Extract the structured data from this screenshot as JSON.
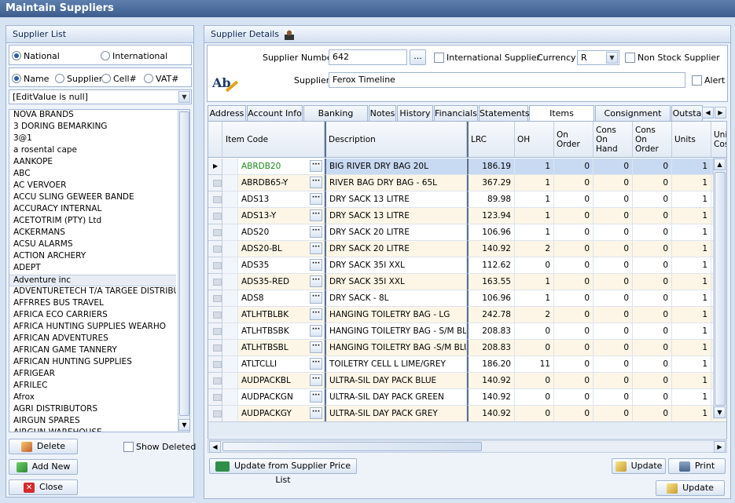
{
  "window": {
    "title": "Maintain Suppliers"
  },
  "left": {
    "header": "Supplier List",
    "scope": {
      "national": "National",
      "international": "International"
    },
    "search_by": {
      "name": "Name",
      "supplier": "Supplier",
      "cell": "Cell#",
      "vat": "VAT#"
    },
    "filter_value": "[EditValue is null]",
    "suppliers": [
      " NOVA BRANDS",
      "3 DORING BEMARKING",
      "3@1",
      "a rosental cape",
      "AANKOPE",
      "ABC",
      "AC VERVOER",
      "ACCU SLING GEWEER BANDE",
      "ACCURACY INTERNAL",
      "ACETOTRIM (PTY) Ltd",
      "ACKERMANS",
      "ACSU ALARMS",
      "ACTION ARCHERY",
      "ADEPT",
      "Adventure inc",
      "ADVENTURETECH T/A TARGEE DISTRIBUT",
      "AFFRRES BUS TRAVEL",
      "AFRICA ECO CARRIERS",
      "AFRICA HUNTING SUPPLIES WEARHO",
      "AFRICAN ADVENTURES",
      "AFRICAN GAME TANNERY",
      "AFRICAN HUNTING SUPPLIES",
      "AFRIGEAR",
      "AFRILEC",
      "Afrox",
      "AGRI DISTRIBUTORS",
      "AIRGUN SPARES",
      "AIRGUN WAREHOUSE"
    ],
    "selected_index": 14,
    "delete_label": "Delete",
    "show_deleted_label": "Show Deleted",
    "add_new_label": "Add New",
    "close_label": "Close"
  },
  "right": {
    "header": "Supplier Details",
    "supplier_number_label": "Supplier Number",
    "supplier_number": "642",
    "ellipsis": "...",
    "international_label": "International Supplier",
    "currency_label": "Currency",
    "currency": "R",
    "non_stock_label": "Non Stock Supplier",
    "supplier_label": "Supplier",
    "supplier_name": "Ferox Timeline",
    "alert_label": "Alert",
    "spell_icon_text": "Ab",
    "tabs": [
      "Address",
      "Account Info",
      "Banking Details",
      "Notes",
      "History",
      "Financials",
      "Statements",
      "Items Supplied",
      "Consignment Stock",
      "Outsta"
    ],
    "grid": {
      "columns": [
        "Item Code",
        "Description",
        "LRC",
        "OH",
        "On Order",
        "Cons On Hand",
        "Cons On Order",
        "Units",
        "Unit Cost"
      ],
      "rows": [
        [
          "ABRDB20",
          "BIG RIVER DRY BAG 20L",
          "186.19",
          "1",
          "0",
          "0",
          "0",
          "1"
        ],
        [
          "ABRDB65-Y",
          "RIVER BAG  DRY BAG - 65L",
          "367.29",
          "1",
          "0",
          "0",
          "0",
          "1"
        ],
        [
          "ADS13",
          "DRY SACK 13 LITRE",
          "89.98",
          "1",
          "0",
          "0",
          "0",
          "1"
        ],
        [
          "ADS13-Y",
          "DRY SACK 13 LITRE",
          "123.94",
          "1",
          "0",
          "0",
          "0",
          "1"
        ],
        [
          "ADS20",
          "DRY SACK 20 LITRE",
          "106.96",
          "1",
          "0",
          "0",
          "0",
          "1"
        ],
        [
          "ADS20-BL",
          "DRY SACK 20 LITRE",
          "140.92",
          "2",
          "0",
          "0",
          "0",
          "1"
        ],
        [
          "ADS35",
          "DRY SACK 35I XXL",
          "112.62",
          "0",
          "0",
          "0",
          "0",
          "1"
        ],
        [
          "ADS35-RED",
          "DRY SACK 35I XXL",
          "163.55",
          "1",
          "0",
          "0",
          "0",
          "1"
        ],
        [
          "ADS8",
          "DRY SACK - 8L",
          "106.96",
          "1",
          "0",
          "0",
          "0",
          "1"
        ],
        [
          "ATLHTBLBK",
          "HANGING TOILETRY BAG - LG",
          "242.78",
          "2",
          "0",
          "0",
          "0",
          "1"
        ],
        [
          "ATLHTBSBK",
          "HANGING TOILETRY BAG  - S/M BLK",
          "208.83",
          "0",
          "0",
          "0",
          "0",
          "1"
        ],
        [
          "ATLHTBSBL",
          "HANGING TOILETRY BAG -S/M BLUE",
          "208.83",
          "0",
          "0",
          "0",
          "0",
          "1"
        ],
        [
          "ATLTCLLI",
          " TOILETRY CELL L LIME/GREY",
          "186.20",
          "11",
          "0",
          "0",
          "0",
          "1"
        ],
        [
          "AUDPACKBL",
          "ULTRA-SIL DAY PACK BLUE",
          "140.92",
          "0",
          "0",
          "0",
          "0",
          "1"
        ],
        [
          "AUDPACKGN",
          "ULTRA-SIL DAY PACK GREEN",
          "140.92",
          "0",
          "0",
          "0",
          "0",
          "1"
        ],
        [
          "AUDPACKGY",
          "ULTRA-SIL DAY PACK GREY",
          "140.92",
          "0",
          "0",
          "0",
          "0",
          "1"
        ]
      ]
    },
    "update_from_price_list_label": "Update from Supplier Price List",
    "update_label": "Update",
    "print_label": "Print",
    "bottom_update_label": "Update"
  }
}
